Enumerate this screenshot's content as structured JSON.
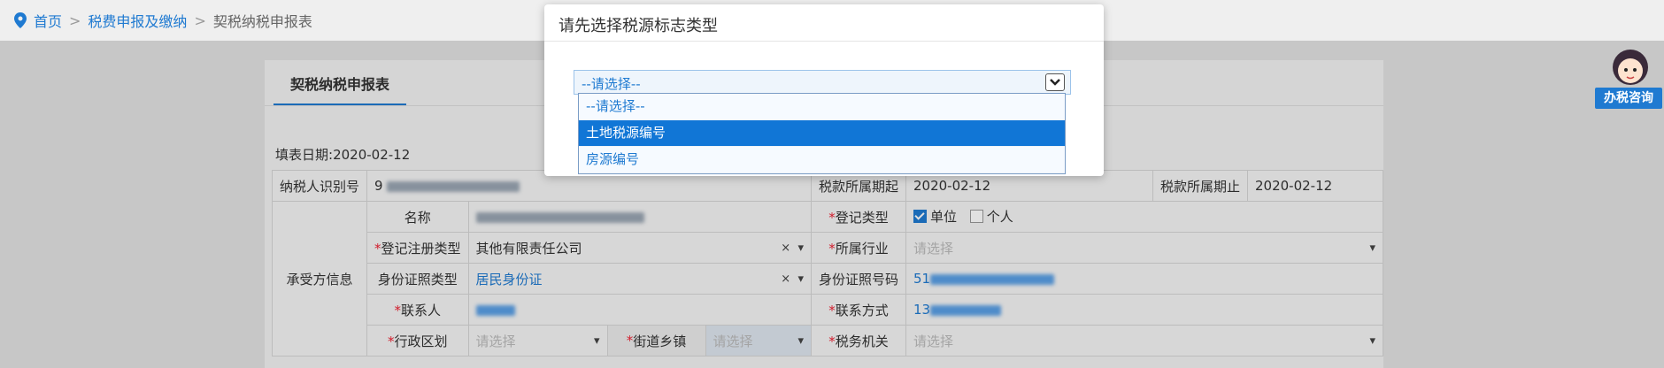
{
  "breadcrumb": {
    "home": "首页",
    "level1": "税费申报及缴纳",
    "current": "契税纳税申报表",
    "separator": ">"
  },
  "card": {
    "tab": "契税纳税申报表",
    "fill_date_label": "填表日期:",
    "fill_date": "2020-02-12"
  },
  "form": {
    "taxpayer_id_label": "纳税人识别号",
    "taxpayer_id_prefix": "9",
    "period_start_label": "税款所属期起",
    "period_start": "2020-02-12",
    "period_end_label": "税款所属期止",
    "period_end": "2020-02-12",
    "section_label": "承受方信息",
    "name_label": "名称",
    "reg_type_label": "登记类型",
    "reg_type_unit": "单位",
    "reg_type_personal": "个人",
    "reg_reg_type_label": "登记注册类型",
    "reg_reg_type_value": "其他有限责任公司",
    "industry_label": "所属行业",
    "industry_placeholder": "请选择",
    "id_type_label": "身份证照类型",
    "id_type_value": "居民身份证",
    "id_no_label": "身份证照号码",
    "id_no_prefix": "51",
    "contact_label": "联系人",
    "phone_label": "联系方式",
    "phone_prefix": "13",
    "district_label": "行政区划",
    "district_placeholder": "请选择",
    "street_label": "街道乡镇",
    "street_placeholder": "请选择",
    "tax_office_label": "税务机关",
    "tax_office_placeholder": "请选择",
    "clear_symbol": "×",
    "dropdown_symbol": "▾"
  },
  "modal": {
    "title": "请先选择税源标志类型",
    "select_value": "--请选择--",
    "options": [
      "--请选择--",
      "土地税源编号",
      "房源编号"
    ],
    "selected_index": 1
  },
  "assistant": {
    "button_label": "办税咨询"
  },
  "colors": {
    "accent": "#1f7ad1",
    "selected_option": "#1176d6",
    "required": "#ee2233"
  }
}
